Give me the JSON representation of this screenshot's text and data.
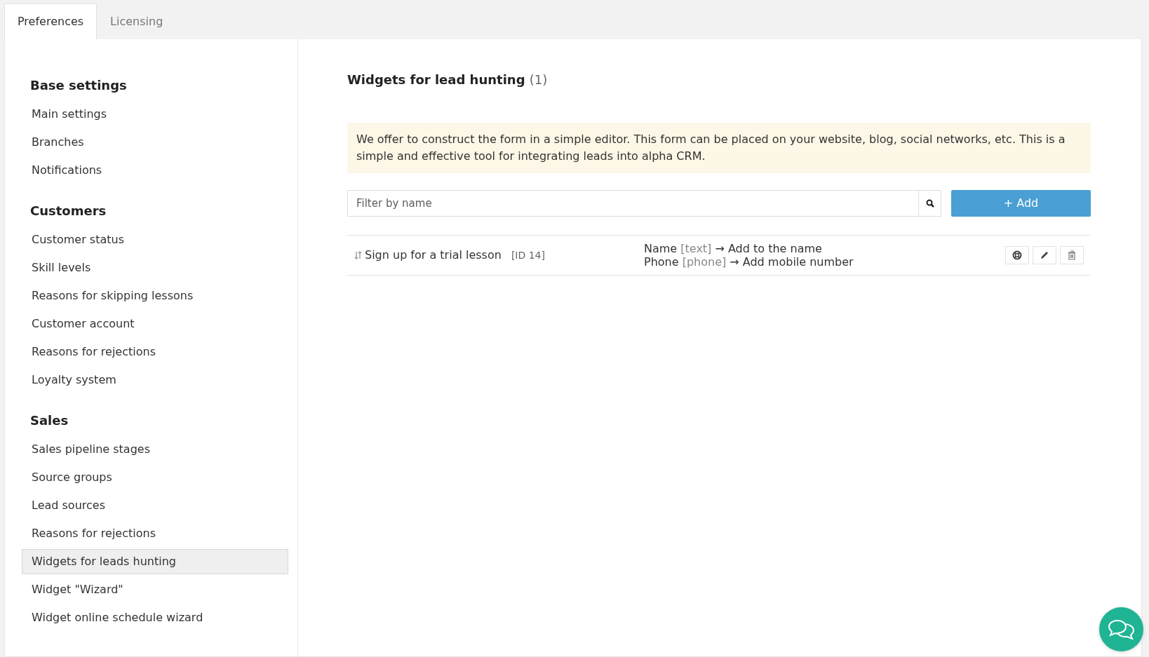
{
  "tabs": [
    {
      "label": "Preferences",
      "selected": true
    },
    {
      "label": "Licensing",
      "selected": false
    }
  ],
  "sidebar": {
    "groups": [
      {
        "title": "Base settings",
        "items": [
          {
            "label": "Main settings",
            "selected": false
          },
          {
            "label": "Branches",
            "selected": false
          },
          {
            "label": "Notifications",
            "selected": false
          }
        ]
      },
      {
        "title": "Customers",
        "items": [
          {
            "label": "Customer status",
            "selected": false
          },
          {
            "label": "Skill levels",
            "selected": false
          },
          {
            "label": "Reasons for skipping lessons",
            "selected": false
          },
          {
            "label": "Customer account",
            "selected": false
          },
          {
            "label": "Reasons for rejections",
            "selected": false
          },
          {
            "label": "Loyalty system",
            "selected": false
          }
        ]
      },
      {
        "title": "Sales",
        "items": [
          {
            "label": "Sales pipeline stages",
            "selected": false
          },
          {
            "label": "Source groups",
            "selected": false
          },
          {
            "label": "Lead sources",
            "selected": false
          },
          {
            "label": "Reasons for rejections",
            "selected": false
          },
          {
            "label": "Widgets for leads hunting",
            "selected": true
          },
          {
            "label": "Widget \"Wizard\"",
            "selected": false
          },
          {
            "label": "Widget online schedule wizard",
            "selected": false
          }
        ]
      }
    ]
  },
  "content": {
    "title": "Widgets for lead hunting",
    "count": "(1)",
    "notice": "We offer to construct the form in a simple editor. This form can be placed on your website, blog, social networks, etc. This is a simple and effective tool for integrating leads into alpha CRM.",
    "filter": {
      "placeholder": "Filter by name"
    },
    "add_button": "+ Add",
    "widgets": [
      {
        "name": "Sign up for a trial lesson",
        "id": "[ID 14]",
        "fields": [
          {
            "field": "Name",
            "type": "[text]",
            "target": "→ Add to the name"
          },
          {
            "field": "Phone",
            "type": "[phone]",
            "target": "→ Add mobile number"
          }
        ]
      }
    ]
  }
}
